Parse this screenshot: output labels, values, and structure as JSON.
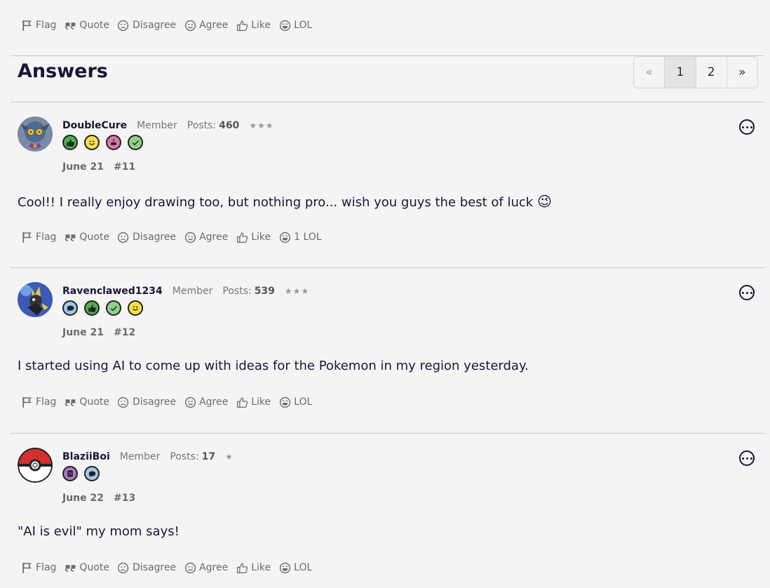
{
  "actions": {
    "flag": "Flag",
    "quote": "Quote",
    "disagree": "Disagree",
    "agree": "Agree",
    "like": "Like",
    "lol": "LOL",
    "lol_with_count": "1 LOL"
  },
  "answers_title": "Answers",
  "pagination": {
    "prev": "«",
    "pages": [
      "1",
      "2"
    ],
    "next": "»",
    "current": "1"
  },
  "posts": [
    {
      "username": "DoubleCure",
      "role": "Member",
      "posts_label": "Posts:",
      "posts_count": "460",
      "stars": "★★★",
      "date": "June 21",
      "number": "#11",
      "text": "Cool!! I really enjoy drawing too, but nothing pro... wish you guys the best of luck",
      "emoji": "😉",
      "badges": [
        "thumbs-up-badge",
        "wink-badge",
        "cake-badge",
        "check-badge"
      ]
    },
    {
      "username": "Ravenclawed1234",
      "role": "Member",
      "posts_label": "Posts:",
      "posts_count": "539",
      "stars": "★★★",
      "date": "June 21",
      "number": "#12",
      "text": "I started using AI to come up with ideas for the Pokemon in my region yesterday.",
      "badges": [
        "speech-badge",
        "thumbs-up-badge",
        "check-badge",
        "wink-badge"
      ]
    },
    {
      "username": "BlaziiBoi",
      "role": "Member",
      "posts_label": "Posts:",
      "posts_count": "17",
      "stars": "★",
      "date": "June 22",
      "number": "#13",
      "text": "\"AI is evil\" my mom says!",
      "badges": [
        "at-badge",
        "speech-badge"
      ]
    }
  ],
  "colors": {
    "background": "#f4f4f4",
    "text": "#1e1438",
    "muted": "#6b6b6b",
    "divider": "#c9c9c9"
  }
}
